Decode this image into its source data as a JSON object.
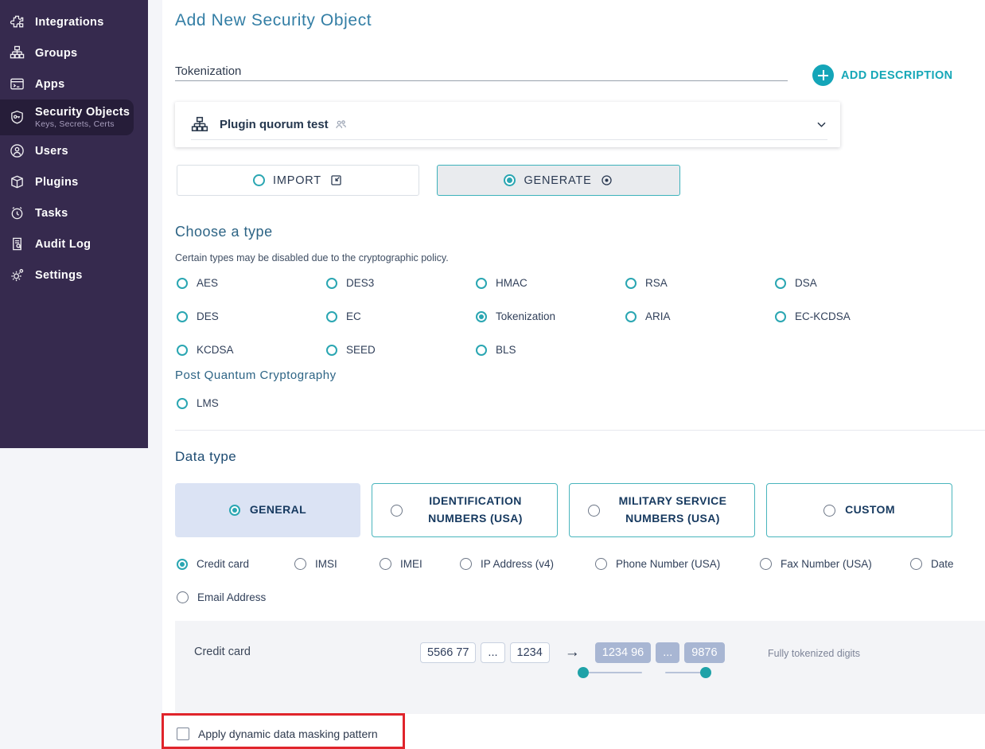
{
  "sidebar": {
    "items": [
      {
        "label": "Integrations",
        "icon": "puzzle-icon"
      },
      {
        "label": "Groups",
        "icon": "org-chart-icon"
      },
      {
        "label": "Apps",
        "icon": "apps-icon"
      },
      {
        "label": "Security Objects",
        "sublabel": "Keys, Secrets, Certs",
        "icon": "shield-key-icon",
        "active": true
      },
      {
        "label": "Users",
        "icon": "user-icon"
      },
      {
        "label": "Plugins",
        "icon": "plugin-box-icon"
      },
      {
        "label": "Tasks",
        "icon": "alarm-clock-icon"
      },
      {
        "label": "Audit Log",
        "icon": "audit-log-icon"
      },
      {
        "label": "Settings",
        "icon": "gear-icon"
      }
    ]
  },
  "header": {
    "title": "Add New Security Object"
  },
  "name_field": {
    "value": "Tokenization"
  },
  "add_description": {
    "label": "ADD DESCRIPTION"
  },
  "group_selector": {
    "name": "Plugin quorum test"
  },
  "method": {
    "import_label": "IMPORT",
    "generate_label": "GENERATE",
    "selected": "GENERATE"
  },
  "choose_type": {
    "heading": "Choose a type",
    "note": "Certain types may be disabled due to the cryptographic policy.",
    "options": [
      "AES",
      "DES3",
      "HMAC",
      "RSA",
      "DSA",
      "DES",
      "EC",
      "Tokenization",
      "ARIA",
      "EC-KCDSA",
      "KCDSA",
      "SEED",
      "BLS"
    ],
    "selected": "Tokenization",
    "pqc_heading": "Post Quantum Cryptography",
    "pqc_options": [
      "LMS"
    ]
  },
  "data_type": {
    "heading": "Data type",
    "cards": [
      "GENERAL",
      "IDENTIFICATION NUMBERS (USA)",
      "MILITARY SERVICE NUMBERS (USA)",
      "CUSTOM"
    ],
    "selected_card": "GENERAL",
    "options": [
      "Credit card",
      "IMSI",
      "IMEI",
      "IP Address (v4)",
      "Phone Number (USA)",
      "Fax Number (USA)",
      "Date",
      "Email Address"
    ],
    "selected_option": "Credit card"
  },
  "preview": {
    "label": "Credit card",
    "source_tokens": [
      "5566 77",
      "...",
      "1234"
    ],
    "arrow": "→",
    "masked_tokens": [
      "1234 96",
      "...",
      "9876"
    ],
    "caption": "Fully tokenized digits"
  },
  "masking": {
    "label": "Apply dynamic data masking pattern",
    "checked": false
  },
  "colors": {
    "sidebar_bg": "#362a4e",
    "sidebar_active_bg": "#261d39",
    "accent_teal": "#2aa6b2",
    "heading_blue": "#337ea5",
    "selected_card_bg": "#dbe3f4",
    "token_fill": "#a8b6d3",
    "annotation_red": "#e0242b"
  }
}
